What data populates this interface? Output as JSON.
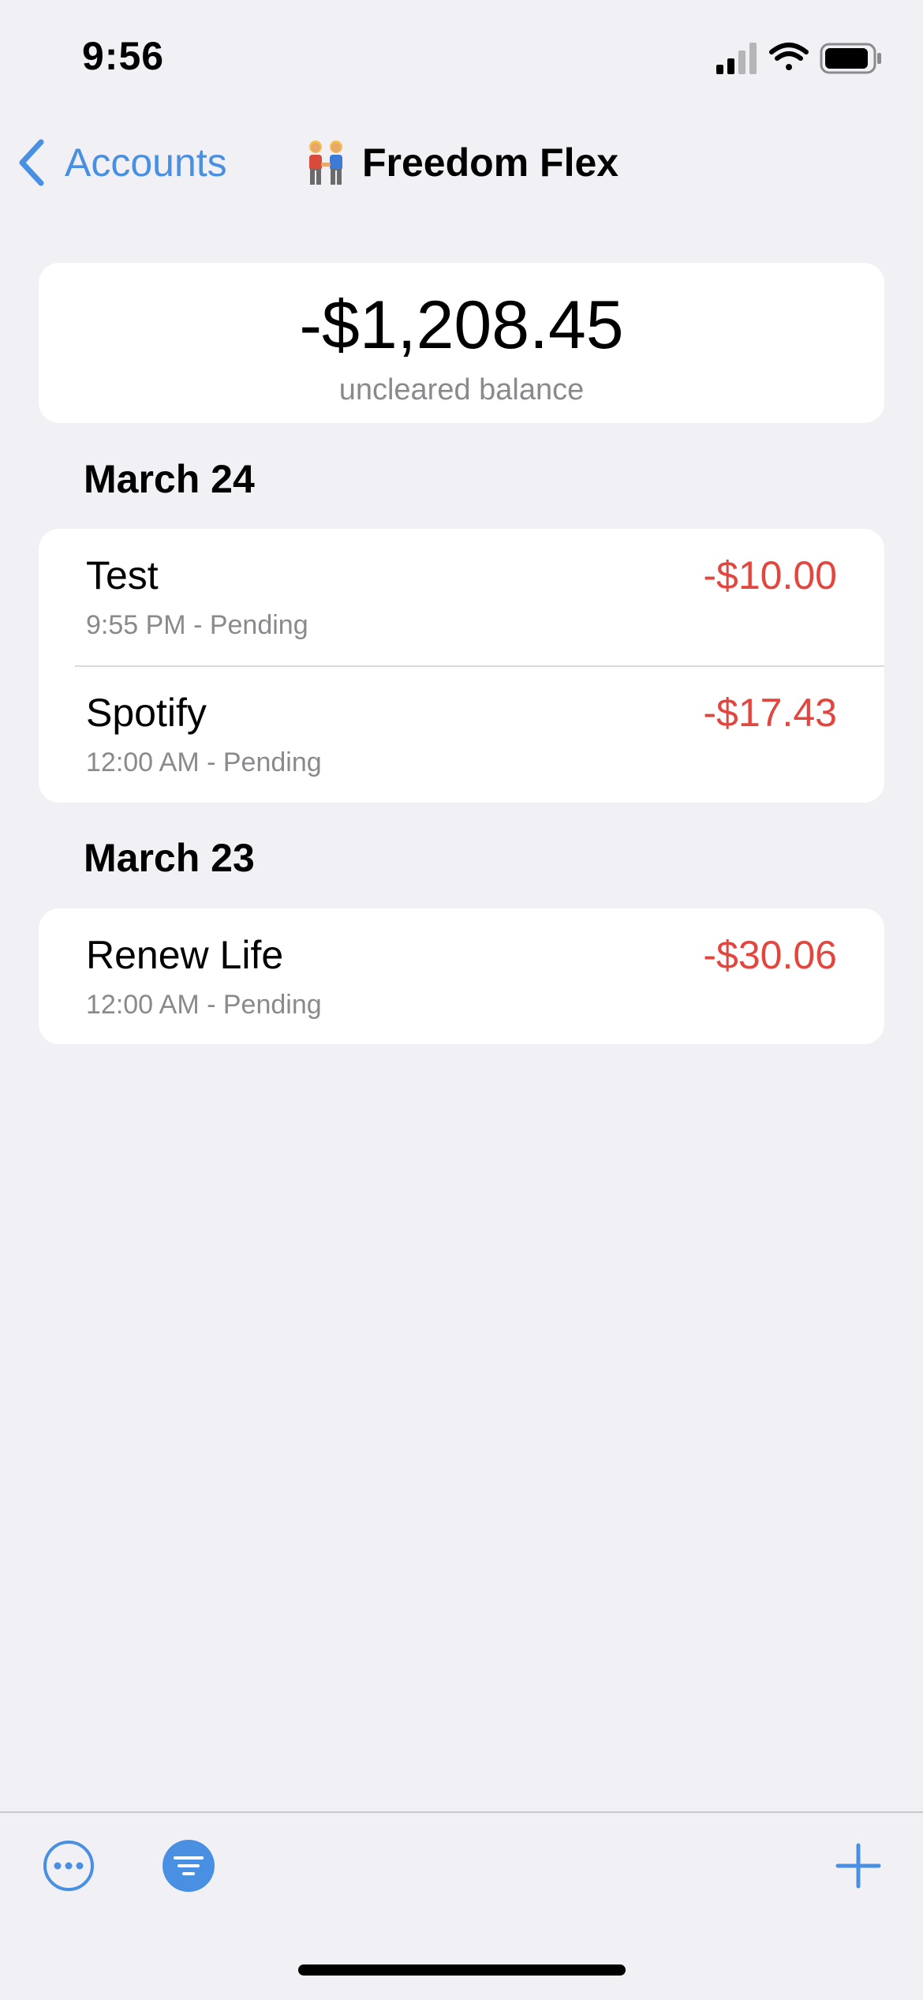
{
  "status_bar": {
    "time": "9:56",
    "icons": [
      "signal-icon",
      "wifi-icon",
      "battery-icon"
    ]
  },
  "nav": {
    "back_label": "Accounts",
    "title": "Freedom Flex",
    "title_emoji": "two-people-holding-hands-icon"
  },
  "balance": {
    "amount": "-$1,208.45",
    "label": "uncleared balance"
  },
  "sections": [
    {
      "header": "March 24",
      "transactions": [
        {
          "name": "Test",
          "subtitle": "9:55 PM - Pending",
          "amount": "-$10.00"
        },
        {
          "name": "Spotify",
          "subtitle": "12:00 AM - Pending",
          "amount": "-$17.43"
        }
      ]
    },
    {
      "header": "March 23",
      "transactions": [
        {
          "name": "Renew Life",
          "subtitle": "12:00 AM - Pending",
          "amount": "-$30.06"
        }
      ]
    }
  ],
  "toolbar": {
    "items": [
      "more-icon",
      "filter-icon",
      "plus-icon"
    ]
  },
  "colors": {
    "accent": "#4a90e2",
    "negative": "#e2463e",
    "background": "#f0f0f5",
    "secondary_text": "#8a8a8e"
  }
}
